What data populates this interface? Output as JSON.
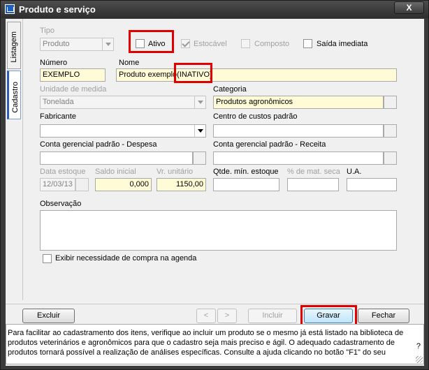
{
  "window": {
    "title": "Produto e serviço",
    "close_label": "X"
  },
  "sidetabs": {
    "listagem": "Listagem",
    "cadastro": "Cadastro"
  },
  "tipo": {
    "label": "Tipo",
    "value": "Produto"
  },
  "checks": {
    "ativo": {
      "label": "Ativo",
      "checked": false
    },
    "estocavel": {
      "label": "Estocável",
      "checked": true
    },
    "composto": {
      "label": "Composto",
      "checked": false
    },
    "saida_imediata": {
      "label": "Saída imediata",
      "checked": false
    }
  },
  "numero": {
    "label": "Número",
    "value": "EXEMPLO"
  },
  "nome": {
    "label": "Nome",
    "value": "Produto exemplo",
    "status": "(INATIVO)"
  },
  "unidade": {
    "label": "Unidade de medida",
    "value": "Tonelada"
  },
  "categoria": {
    "label": "Categoria",
    "value": "Produtos agronômicos"
  },
  "fabricante": {
    "label": "Fabricante",
    "value": ""
  },
  "centro_custos": {
    "label": "Centro de custos padrão",
    "value": ""
  },
  "conta_despesa": {
    "label": "Conta gerencial padrão - Despesa",
    "value": ""
  },
  "conta_receita": {
    "label": "Conta gerencial padrão - Receita",
    "value": ""
  },
  "data_estoque": {
    "label": "Data estoque",
    "value": "12/03/13"
  },
  "saldo_inicial": {
    "label": "Saldo inicial",
    "value": "0,000"
  },
  "vr_unitario": {
    "label": "Vr. unitário",
    "value": "1150,00"
  },
  "qtde_min": {
    "label": "Qtde. mín. estoque",
    "value": ""
  },
  "mat_seca": {
    "label": "% de mat. seca",
    "value": ""
  },
  "ua": {
    "label": "U.A.",
    "value": ""
  },
  "observacao": {
    "label": "Observação",
    "value": ""
  },
  "exibir": {
    "label": "Exibir necessidade de compra na agenda",
    "checked": false
  },
  "buttons": {
    "excluir": "Excluir",
    "prev": "<",
    "next": ">",
    "incluir": "Incluir",
    "gravar": "Gravar",
    "fechar": "Fechar"
  },
  "help": {
    "text": "Para facilitar ao cadastramento dos itens, verifique ao incluir um produto se o mesmo já está listado na biblioteca de produtos veterinários e agronômicos para que o cadastro seja mais preciso e ágil. O adequado cadastramento de produtos tornará possível a realização de análises específicas. Consulte a ajuda clicando no botão \"F1\" do seu",
    "q": "?"
  },
  "colors": {
    "highlight": "#e00000",
    "yellow_field": "#fffbd6",
    "titlebar": "#3a3a3a"
  }
}
